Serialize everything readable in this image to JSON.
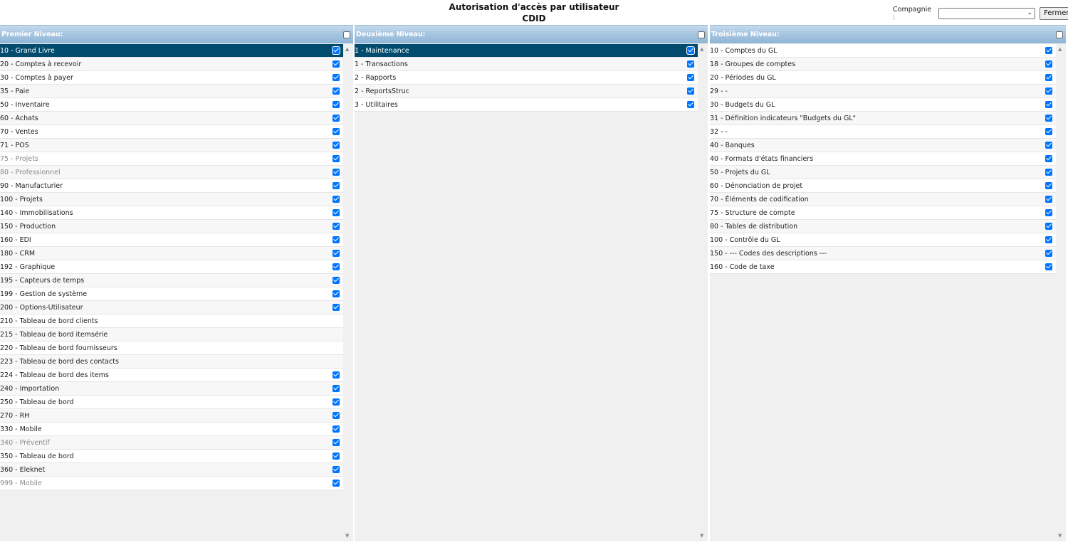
{
  "header": {
    "title": "Autorisation d'accès par utilisateur",
    "subtitle": "CDID"
  },
  "company": {
    "label": "Compagnie :",
    "value": "",
    "close_label": "Fermer"
  },
  "panels": [
    {
      "header": "Premier Niveau:",
      "items": [
        {
          "label": "10 - Grand Livre",
          "checked": true,
          "selected": true,
          "muted": false
        },
        {
          "label": "20 - Comptes à recevoir",
          "checked": true,
          "selected": false,
          "muted": false
        },
        {
          "label": "30 - Comptes à payer",
          "checked": true,
          "selected": false,
          "muted": false
        },
        {
          "label": "35 - Paie",
          "checked": true,
          "selected": false,
          "muted": false
        },
        {
          "label": "50 - Inventaire",
          "checked": true,
          "selected": false,
          "muted": false
        },
        {
          "label": "60 - Achats",
          "checked": true,
          "selected": false,
          "muted": false
        },
        {
          "label": "70 - Ventes",
          "checked": true,
          "selected": false,
          "muted": false
        },
        {
          "label": "71 - POS",
          "checked": true,
          "selected": false,
          "muted": false
        },
        {
          "label": "75 - Projets",
          "checked": true,
          "selected": false,
          "muted": true
        },
        {
          "label": "80 - Professionnel",
          "checked": true,
          "selected": false,
          "muted": true
        },
        {
          "label": "90 - Manufacturier",
          "checked": true,
          "selected": false,
          "muted": false
        },
        {
          "label": "100 - Projets",
          "checked": true,
          "selected": false,
          "muted": false
        },
        {
          "label": "140 - Immobilisations",
          "checked": true,
          "selected": false,
          "muted": false
        },
        {
          "label": "150 - Production",
          "checked": true,
          "selected": false,
          "muted": false
        },
        {
          "label": "160 - EDI",
          "checked": true,
          "selected": false,
          "muted": false
        },
        {
          "label": "180 - CRM",
          "checked": true,
          "selected": false,
          "muted": false
        },
        {
          "label": "192 - Graphique",
          "checked": true,
          "selected": false,
          "muted": false
        },
        {
          "label": "195 - Capteurs de temps",
          "checked": true,
          "selected": false,
          "muted": false
        },
        {
          "label": "199 - Gestion de système",
          "checked": true,
          "selected": false,
          "muted": false
        },
        {
          "label": "200 - Options-Utilisateur",
          "checked": true,
          "selected": false,
          "muted": false
        },
        {
          "label": "210 - Tableau de bord clients",
          "checked": false,
          "selected": false,
          "muted": false
        },
        {
          "label": "215 - Tableau de bord itemsérie",
          "checked": false,
          "selected": false,
          "muted": false
        },
        {
          "label": "220 - Tableau de bord fournisseurs",
          "checked": false,
          "selected": false,
          "muted": false
        },
        {
          "label": "223 - Tableau de bord des contacts",
          "checked": false,
          "selected": false,
          "muted": false
        },
        {
          "label": "224 - Tableau de bord des items",
          "checked": true,
          "selected": false,
          "muted": false
        },
        {
          "label": "240 - Importation",
          "checked": true,
          "selected": false,
          "muted": false
        },
        {
          "label": "250 - Tableau de bord",
          "checked": true,
          "selected": false,
          "muted": false
        },
        {
          "label": "270 - RH",
          "checked": true,
          "selected": false,
          "muted": false
        },
        {
          "label": "330 - Mobile",
          "checked": true,
          "selected": false,
          "muted": false
        },
        {
          "label": "340 - Préventif",
          "checked": true,
          "selected": false,
          "muted": true
        },
        {
          "label": "350 - Tableau de bord",
          "checked": true,
          "selected": false,
          "muted": false
        },
        {
          "label": "360 - Eleknet",
          "checked": true,
          "selected": false,
          "muted": false
        },
        {
          "label": "999 - Mobile",
          "checked": true,
          "selected": false,
          "muted": true
        }
      ]
    },
    {
      "header": "Deuxième Niveau:",
      "items": [
        {
          "label": "1 - Maintenance",
          "checked": true,
          "selected": true,
          "muted": false
        },
        {
          "label": "1 - Transactions",
          "checked": true,
          "selected": false,
          "muted": false
        },
        {
          "label": "2 - Rapports",
          "checked": true,
          "selected": false,
          "muted": false
        },
        {
          "label": "2 - ReportsStruc",
          "checked": true,
          "selected": false,
          "muted": false
        },
        {
          "label": "3 - Utilitaires",
          "checked": true,
          "selected": false,
          "muted": false
        }
      ]
    },
    {
      "header": "Troisième Niveau:",
      "items": [
        {
          "label": "10 - Comptes du GL",
          "checked": true,
          "selected": false,
          "muted": false
        },
        {
          "label": "18 - Groupes de comptes",
          "checked": true,
          "selected": false,
          "muted": false
        },
        {
          "label": "20 - Périodes du GL",
          "checked": true,
          "selected": false,
          "muted": false
        },
        {
          "label": "29 - -",
          "checked": true,
          "selected": false,
          "muted": false
        },
        {
          "label": "30 - Budgets du GL",
          "checked": true,
          "selected": false,
          "muted": false
        },
        {
          "label": "31 - Définition indicateurs \"Budgets du GL\"",
          "checked": true,
          "selected": false,
          "muted": false
        },
        {
          "label": "32 - -",
          "checked": true,
          "selected": false,
          "muted": false
        },
        {
          "label": "40 - Banques",
          "checked": true,
          "selected": false,
          "muted": false
        },
        {
          "label": "40 - Formats d'états financiers",
          "checked": true,
          "selected": false,
          "muted": false
        },
        {
          "label": "50 - Projets du GL",
          "checked": true,
          "selected": false,
          "muted": false
        },
        {
          "label": "60 - Dénonciation de projet",
          "checked": true,
          "selected": false,
          "muted": false
        },
        {
          "label": "70 - Éléments de codification",
          "checked": true,
          "selected": false,
          "muted": false
        },
        {
          "label": "75 - Structure de compte",
          "checked": true,
          "selected": false,
          "muted": false
        },
        {
          "label": "80 - Tables de distribution",
          "checked": true,
          "selected": false,
          "muted": false
        },
        {
          "label": "100 - Contrôle du GL",
          "checked": true,
          "selected": false,
          "muted": false
        },
        {
          "label": "150 - --- Codes des descriptions ---",
          "checked": true,
          "selected": false,
          "muted": false
        },
        {
          "label": "160 - Code de taxe",
          "checked": true,
          "selected": false,
          "muted": false
        }
      ]
    }
  ]
}
